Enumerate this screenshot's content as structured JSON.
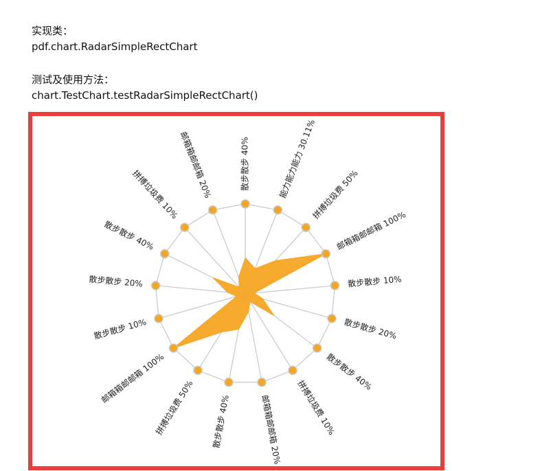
{
  "header": {
    "class_heading": "实现类：",
    "class_name": "pdf.chart.RadarSimpleRectChart",
    "test_heading": "测试及使用方法：",
    "test_call": "chart.TestChart.testRadarSimpleRectChart()"
  },
  "chart_data": {
    "type": "radar",
    "title": "",
    "series": [
      {
        "values": [
          40,
          30.11,
          50,
          100,
          10,
          20,
          40,
          10,
          20,
          40,
          50,
          100,
          10,
          20,
          40,
          10,
          20
        ]
      }
    ],
    "categories": [
      "散步散步 40%",
      "能力能力能力 30.11%",
      "拼搏垃圾费 50%",
      "邮箱箱邮邮箱 100%",
      "散步散步 10%",
      "散步散步 20%",
      "散步散步 40%",
      "拼搏垃圾费 10%",
      "邮箱箱邮邮箱 20%",
      "散步散步 40%",
      "拼搏垃圾费 50%",
      "邮箱箱邮邮箱 100%",
      "散步散步 10%",
      "散步散步 20%",
      "散步散步 40%",
      "拼搏垃圾费 10%",
      "邮箱箱邮邮箱 20%"
    ],
    "range": [
      0,
      100
    ],
    "fill_color": "#f5a623",
    "marker_color": "#f5a623",
    "grid_color": "#c8c8c8",
    "frame_color": "#ee3b3b"
  }
}
